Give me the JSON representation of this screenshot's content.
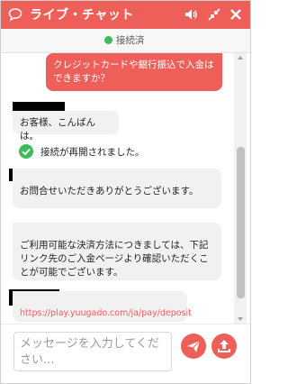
{
  "colors": {
    "accent": "#ef5f59",
    "agent_bubble": "#f1f1f1",
    "online": "#3dbb5c"
  },
  "header": {
    "title": "ライブ・チャット",
    "icons": [
      "chat-bubble-icon",
      "volume-icon",
      "minimize-icon",
      "close-icon"
    ]
  },
  "status": {
    "text": "接続済"
  },
  "messages": {
    "user_question": "クレジットカードや銀行振込で入金はできますか？",
    "greeting": "お客様、こんばんは。",
    "reconnected": "接続が再開されました。",
    "thanks": "お問合せいただきありがとうございます。",
    "payment_info": "ご利用可能な決済方法につきましては、下記リンク先のご入金ページより確認いただくことが可能でございます。",
    "link": "https://play.yuugado.com/ja/pay/deposit"
  },
  "composer": {
    "placeholder": "メッセージを入力してください...",
    "icons": [
      "send-icon",
      "upload-icon"
    ]
  }
}
